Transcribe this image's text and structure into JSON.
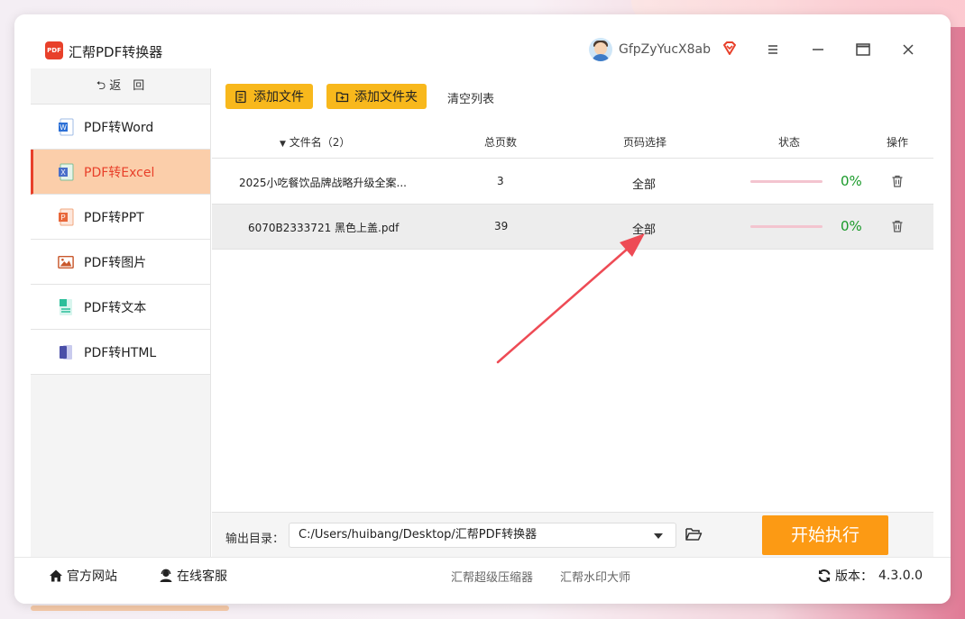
{
  "window": {
    "title": "汇帮PDF转换器",
    "logo_text": "PDF",
    "username": "GfpZyYucX8ab"
  },
  "sidebar": {
    "back_label": "返　回",
    "items": [
      {
        "label": "PDF转Word",
        "icon": "word-file-icon",
        "color": "#2b6fd6"
      },
      {
        "label": "PDF转Excel",
        "icon": "excel-file-icon",
        "color": "#1f8e4a",
        "active": true
      },
      {
        "label": "PDF转PPT",
        "icon": "ppt-file-icon",
        "color": "#e8673a"
      },
      {
        "label": "PDF转图片",
        "icon": "image-file-icon",
        "color": "#c9582c"
      },
      {
        "label": "PDF转文本",
        "icon": "text-file-icon",
        "color": "#2bbf9a"
      },
      {
        "label": "PDF转HTML",
        "icon": "html-file-icon",
        "color": "#4a4fa8"
      }
    ]
  },
  "toolbar": {
    "add_file": "添加文件",
    "add_folder": "添加文件夹",
    "clear_list": "清空列表"
  },
  "table": {
    "headers": {
      "name": "文件名（2）",
      "pages": "总页数",
      "page_select": "页码选择",
      "status": "状态",
      "action": "操作"
    },
    "rows": [
      {
        "name": "2025小吃餐饮品牌战略升级全案...",
        "pages": "3",
        "page_select": "全部",
        "progress": 0,
        "percent": "0%"
      },
      {
        "name": "6070B2333721 黑色上盖.pdf",
        "pages": "39",
        "page_select": "全部",
        "progress": 0,
        "percent": "0%"
      }
    ]
  },
  "output": {
    "label": "输出目录：",
    "path": "C:/Users/huibang/Desktop/汇帮PDF转换器"
  },
  "start_button": "开始执行",
  "footer": {
    "website": "官方网站",
    "support": "在线客服",
    "link1": "汇帮超级压缩器",
    "link2": "汇帮水印大师",
    "version_label": "版本：",
    "version": "4.3.0.0"
  },
  "colors": {
    "accent": "#e8402a",
    "button": "#f8b81c",
    "start": "#fc9a14",
    "success": "#1a9a2a"
  }
}
